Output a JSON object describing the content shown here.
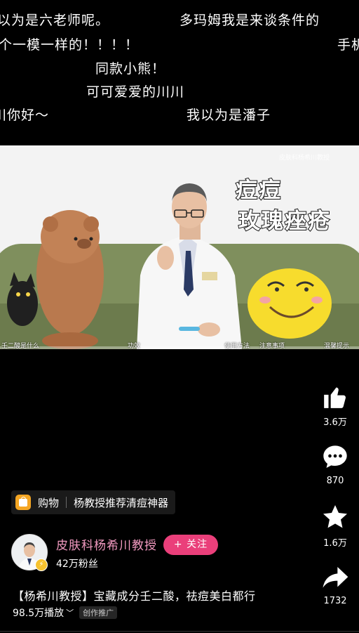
{
  "danmaku": [
    "以为是六老师呢。",
    "多玛姆我是来谈条件的",
    "个一模一样的！！！！",
    "手机",
    "同款小熊！",
    "可可爱爱的川川",
    "川你好～",
    "我以为是潘子"
  ],
  "video": {
    "caption_line1": "痘痘",
    "caption_line2": "玫瑰痤疮",
    "watermark": "皮肤科杨希川教授",
    "chapters": [
      "壬二酸是什么",
      "功效",
      "使用方法",
      "注意事项",
      "温馨提示"
    ]
  },
  "actions": {
    "like_count": "3.6万",
    "comment_count": "870",
    "favorite_count": "1.6万",
    "share_count": "1732"
  },
  "shop": {
    "label": "购物",
    "product": "杨教授推荐清痘神器"
  },
  "author": {
    "name": "皮肤科杨希川教授",
    "follow_label": "+ 关注",
    "fans": "42万粉丝"
  },
  "post": {
    "title": "【杨希川教授】宝藏成分壬二酸，祛痘美白都行",
    "plays": "98.5万播放",
    "promo": "创作推广"
  },
  "colors": {
    "follow_button": "#ea3f7a",
    "author_name": "#f29ac0",
    "shop_icon": "#f5a623"
  }
}
